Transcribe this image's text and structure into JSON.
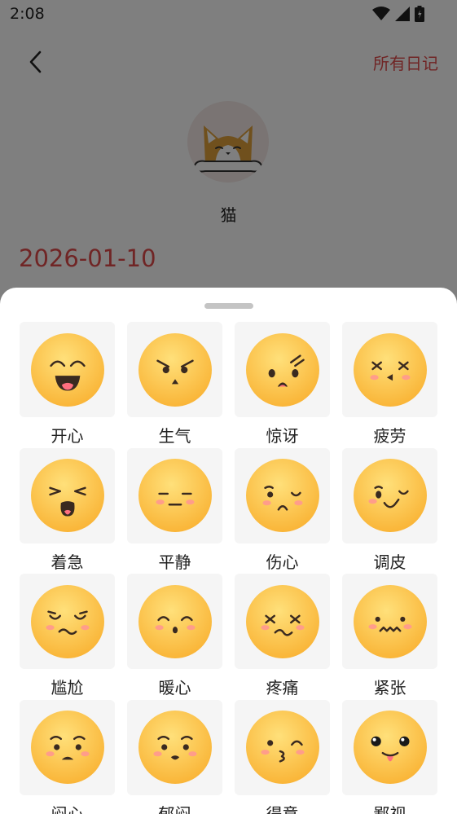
{
  "status_bar": {
    "time": "2:08"
  },
  "header": {
    "all_diaries": "所有日记"
  },
  "pet": {
    "name": "猫"
  },
  "diary": {
    "date": "2026-01-10"
  },
  "moods": [
    {
      "label": "开心",
      "icon": "happy-face-icon"
    },
    {
      "label": "生气",
      "icon": "angry-face-icon"
    },
    {
      "label": "惊讶",
      "icon": "surprised-face-icon"
    },
    {
      "label": "疲劳",
      "icon": "tired-face-icon"
    },
    {
      "label": "着急",
      "icon": "anxious-face-icon"
    },
    {
      "label": "平静",
      "icon": "calm-face-icon"
    },
    {
      "label": "伤心",
      "icon": "sad-face-icon"
    },
    {
      "label": "调皮",
      "icon": "naughty-face-icon"
    },
    {
      "label": "尴尬",
      "icon": "awkward-face-icon"
    },
    {
      "label": "暖心",
      "icon": "warm-face-icon"
    },
    {
      "label": "疼痛",
      "icon": "pain-face-icon"
    },
    {
      "label": "紧张",
      "icon": "nervous-face-icon"
    },
    {
      "label": "闷心",
      "icon": "worried-face-icon"
    },
    {
      "label": "郁闷",
      "icon": "depressed-face-icon"
    },
    {
      "label": "得意",
      "icon": "smug-face-icon"
    },
    {
      "label": "鄙视",
      "icon": "contempt-face-icon"
    }
  ]
}
